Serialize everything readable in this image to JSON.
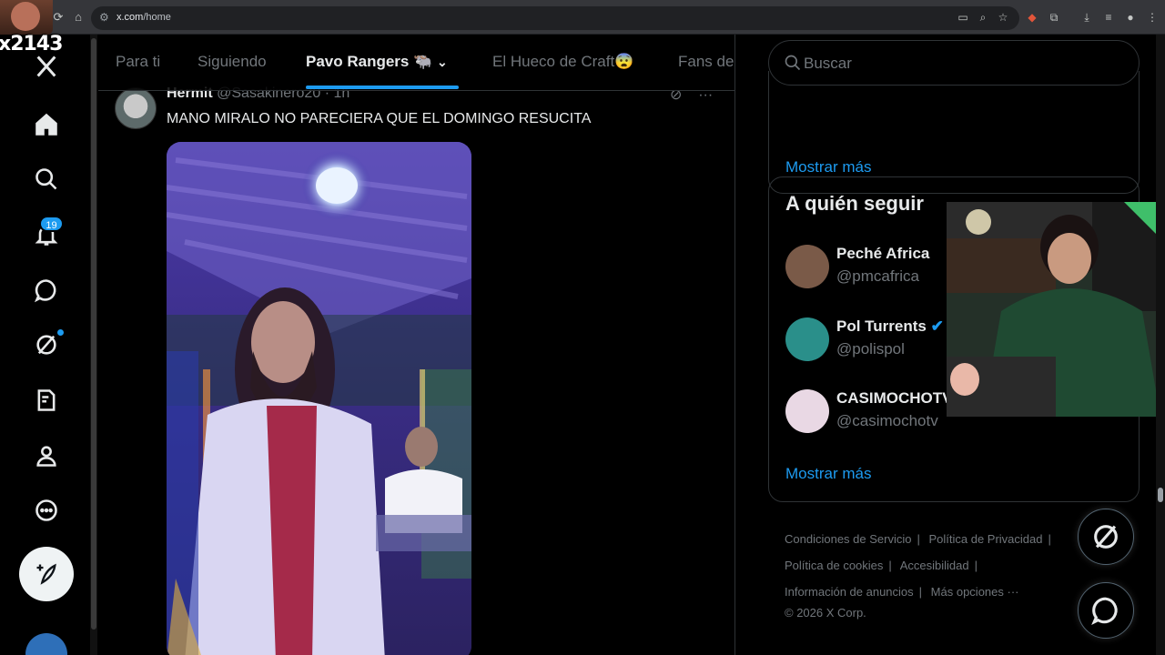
{
  "browser": {
    "url_host": "x.com",
    "url_path": "/home"
  },
  "overlay": {
    "viewer_text": "x2143"
  },
  "nav": {
    "notification_count": "19"
  },
  "tabs": [
    {
      "label": "Para ti"
    },
    {
      "label": "Siguiendo"
    },
    {
      "label": "Pavo Rangers 🐃"
    },
    {
      "label": "El Hueco de Craft😨"
    },
    {
      "label": "Fans de"
    }
  ],
  "tweet": {
    "name": "Hermit",
    "handle": "@Sasakinero20",
    "time": "· 1h",
    "text": "MANO MIRALO NO PARECIERA QUE EL DOMINGO RESUCITA"
  },
  "search": {
    "placeholder": "Buscar"
  },
  "trends": {
    "show_more": "Mostrar más"
  },
  "who_to_follow": {
    "title": "A quién seguir",
    "show_more": "Mostrar más",
    "accounts": [
      {
        "name": "Peché Africa",
        "handle": "@pmcafrica",
        "avatar_color": "#7a5a48"
      },
      {
        "name": "Pol Turrents",
        "handle": "@polispol",
        "avatar_color": "#2a8f8a"
      },
      {
        "name": "CASIMOCHOTV",
        "handle": "@casimochotv",
        "avatar_color": "#e9d8e4"
      }
    ]
  },
  "footer": {
    "terms": "Condiciones de Servicio",
    "privacy": "Política de Privacidad",
    "cookies": "Política de cookies",
    "accessibility": "Accesibilidad",
    "ads_info": "Información de anuncios",
    "more": "Más opciones ···",
    "copyright": "© 2026 X Corp."
  },
  "colors": {
    "accent": "#1d9bf0",
    "background": "#000000",
    "border": "#2f3336"
  }
}
